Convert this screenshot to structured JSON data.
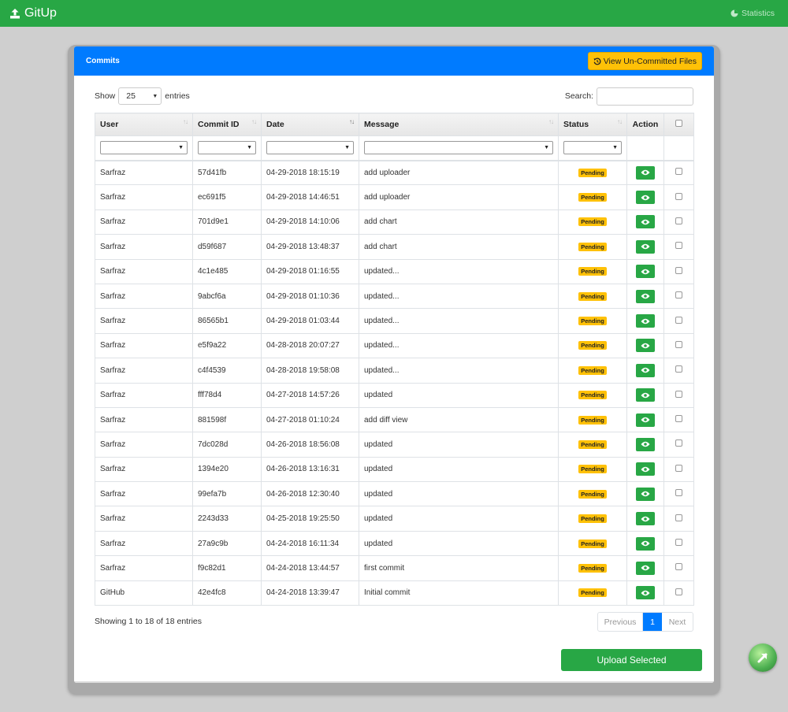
{
  "navbar": {
    "brand": "GitUp",
    "stats_label": "Statistics"
  },
  "panel": {
    "title": "Commits",
    "view_uncommitted_label": "View Un-Committed Files"
  },
  "controls": {
    "show_label": "Show",
    "length_value": "25",
    "entries_label": "entries",
    "search_label": "Search:",
    "search_value": ""
  },
  "table": {
    "columns": [
      "User",
      "Commit ID",
      "Date",
      "Message",
      "Status",
      "Action"
    ],
    "rows": [
      {
        "user": "Sarfraz",
        "commit": "57d41fb",
        "date": "04-29-2018 18:15:19",
        "message": "add uploader",
        "status": "Pending"
      },
      {
        "user": "Sarfraz",
        "commit": "ec691f5",
        "date": "04-29-2018 14:46:51",
        "message": "add uploader",
        "status": "Pending"
      },
      {
        "user": "Sarfraz",
        "commit": "701d9e1",
        "date": "04-29-2018 14:10:06",
        "message": "add chart",
        "status": "Pending"
      },
      {
        "user": "Sarfraz",
        "commit": "d59f687",
        "date": "04-29-2018 13:48:37",
        "message": "add chart",
        "status": "Pending"
      },
      {
        "user": "Sarfraz",
        "commit": "4c1e485",
        "date": "04-29-2018 01:16:55",
        "message": "updated...",
        "status": "Pending"
      },
      {
        "user": "Sarfraz",
        "commit": "9abcf6a",
        "date": "04-29-2018 01:10:36",
        "message": "updated...",
        "status": "Pending"
      },
      {
        "user": "Sarfraz",
        "commit": "86565b1",
        "date": "04-29-2018 01:03:44",
        "message": "updated...",
        "status": "Pending"
      },
      {
        "user": "Sarfraz",
        "commit": "e5f9a22",
        "date": "04-28-2018 20:07:27",
        "message": "updated...",
        "status": "Pending"
      },
      {
        "user": "Sarfraz",
        "commit": "c4f4539",
        "date": "04-28-2018 19:58:08",
        "message": "updated...",
        "status": "Pending"
      },
      {
        "user": "Sarfraz",
        "commit": "fff78d4",
        "date": "04-27-2018 14:57:26",
        "message": "updated",
        "status": "Pending"
      },
      {
        "user": "Sarfraz",
        "commit": "881598f",
        "date": "04-27-2018 01:10:24",
        "message": "add diff view",
        "status": "Pending"
      },
      {
        "user": "Sarfraz",
        "commit": "7dc028d",
        "date": "04-26-2018 18:56:08",
        "message": "updated",
        "status": "Pending"
      },
      {
        "user": "Sarfraz",
        "commit": "1394e20",
        "date": "04-26-2018 13:16:31",
        "message": "updated",
        "status": "Pending"
      },
      {
        "user": "Sarfraz",
        "commit": "99efa7b",
        "date": "04-26-2018 12:30:40",
        "message": "updated",
        "status": "Pending"
      },
      {
        "user": "Sarfraz",
        "commit": "2243d33",
        "date": "04-25-2018 19:25:50",
        "message": "updated",
        "status": "Pending"
      },
      {
        "user": "Sarfraz",
        "commit": "27a9c9b",
        "date": "04-24-2018 16:11:34",
        "message": "updated",
        "status": "Pending"
      },
      {
        "user": "Sarfraz",
        "commit": "f9c82d1",
        "date": "04-24-2018 13:44:57",
        "message": "first commit",
        "status": "Pending"
      },
      {
        "user": "GitHub",
        "commit": "42e4fc8",
        "date": "04-24-2018 13:39:47",
        "message": "Initial commit",
        "status": "Pending"
      }
    ]
  },
  "footer": {
    "info": "Showing 1 to 18 of 18 entries",
    "prev_label": "Previous",
    "current_page": "1",
    "next_label": "Next",
    "upload_label": "Upload Selected"
  },
  "icons": {
    "brand": "upload-icon",
    "stats": "pie-chart-icon",
    "view_uncommitted": "history-icon",
    "row_action": "eye-icon",
    "floating": "arrow-up-right-icon"
  },
  "colors": {
    "navbar": "#28a745",
    "panel_header": "#007bff",
    "warning": "#ffc107",
    "success": "#28a745",
    "primary": "#007bff",
    "background": "#cfcfcf"
  }
}
